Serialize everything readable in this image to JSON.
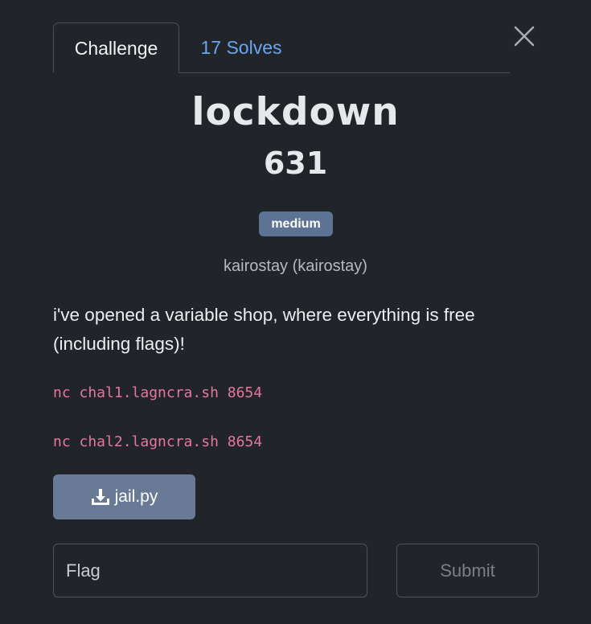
{
  "tabs": {
    "challenge": "Challenge",
    "solves": "17 Solves"
  },
  "challenge": {
    "name": "lockdown",
    "points": "631",
    "difficulty": "medium",
    "author": "kairostay (kairostay)",
    "description": "i've opened a variable shop, where everything is free (including flags)!",
    "connections": [
      "nc chal1.lagncra.sh 8654",
      "nc chal2.lagncra.sh 8654"
    ],
    "file": "jail.py"
  },
  "form": {
    "flag_placeholder": "Flag",
    "submit_label": "Submit"
  },
  "colors": {
    "background": "#212429",
    "accent_tab": "#6aa5ef",
    "badge": "#5d7394",
    "download_button": "#687a95",
    "code": "#e5779f"
  },
  "icons": {
    "close": "close-icon",
    "download": "download-icon"
  }
}
